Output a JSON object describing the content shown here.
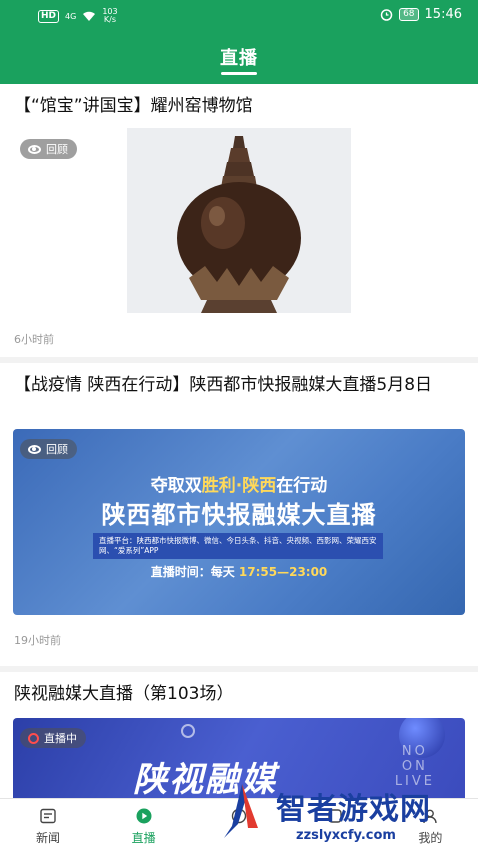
{
  "status_bar": {
    "hd": "HD",
    "signal": "4G",
    "speed_value": "103",
    "speed_unit": "K/s",
    "battery": "68",
    "time": "15:46"
  },
  "header": {
    "title": "直播"
  },
  "feed": [
    {
      "title": "【“馆宝”讲国宝】耀州窑博物馆",
      "badge": "回顾",
      "time": "6小时前",
      "image_icon": "artifact-photo"
    },
    {
      "title": "【战疫情 陕西在行动】陕西都市快报融媒大直播5月8日",
      "badge": "回顾",
      "time": "19小时前",
      "banner": {
        "line1_pre": "夺取双",
        "line1_hl": "胜利·陕西",
        "line1_post": "在行动",
        "line2": "陕西都市快报融媒大直播",
        "platform": "直播平台：陕西都市快报微博、微信、今日头条、抖音、央视频、西影网、荣耀西安网、“爱系列”APP",
        "schedule_label": "直播时间：每天 ",
        "schedule_time": "17:55—23:00"
      }
    },
    {
      "title": "陕视融媒大直播（第103场）",
      "badge": "直播中",
      "banner": {
        "big": "陕视融媒",
        "side": "NO\nON\nLIVE"
      }
    }
  ],
  "bottom_nav": [
    {
      "label": "新闻",
      "icon": "news-icon",
      "active": false
    },
    {
      "label": "直播",
      "icon": "live-play-icon",
      "active": true
    },
    {
      "label": "",
      "icon": "service-icon",
      "active": false
    },
    {
      "label": "",
      "icon": "discover-icon",
      "active": false
    },
    {
      "label": "我的",
      "icon": "profile-icon",
      "active": false
    }
  ],
  "watermark": {
    "title": "智者游戏网",
    "url": "zzslyxcfy.com"
  },
  "colors": {
    "brand_green": "#1aa15e",
    "live_red": "#ff4d4d"
  }
}
